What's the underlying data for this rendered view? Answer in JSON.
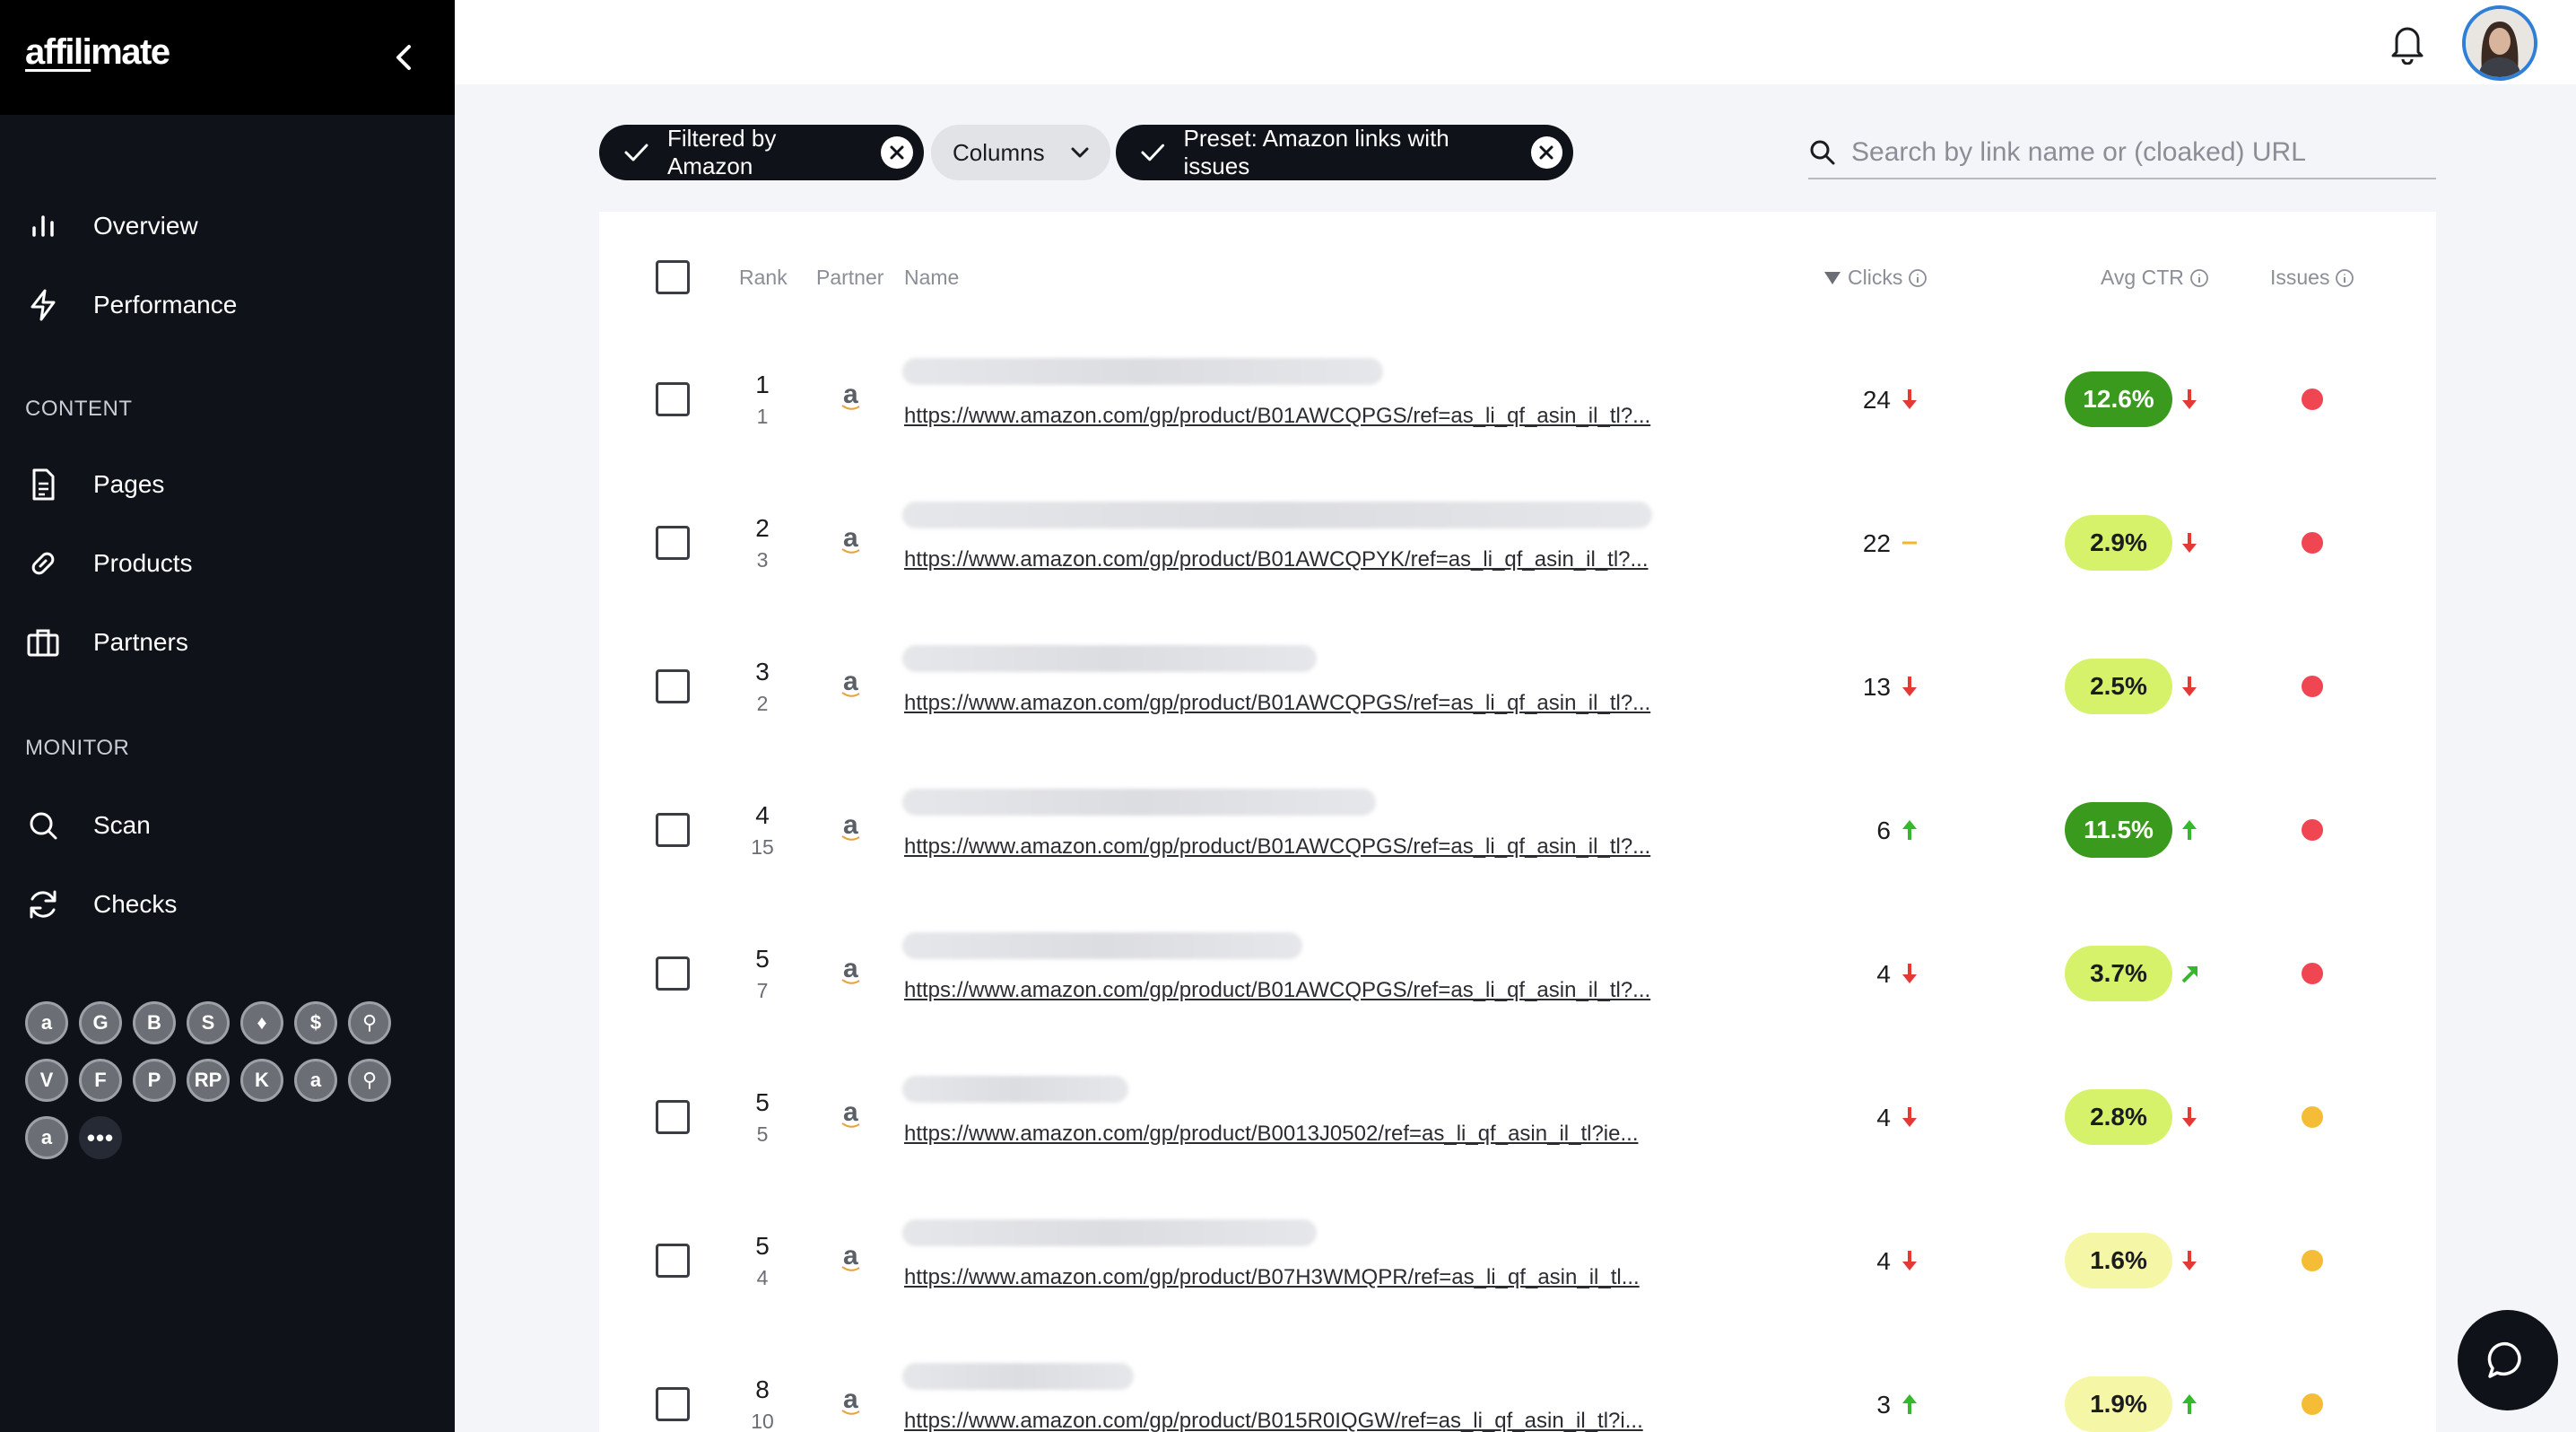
{
  "app": {
    "logo_prefix": "affili",
    "logo_suffix": "mate"
  },
  "sidebar": {
    "nav": [
      {
        "label": "Overview",
        "icon": "bar-chart-icon"
      },
      {
        "label": "Performance",
        "icon": "lightning-icon"
      }
    ],
    "content_section": "CONTENT",
    "content_items": [
      {
        "label": "Pages",
        "icon": "document-icon"
      },
      {
        "label": "Products",
        "icon": "link-icon"
      },
      {
        "label": "Partners",
        "icon": "briefcase-icon"
      }
    ],
    "monitor_section": "MONITOR",
    "monitor_items": [
      {
        "label": "Scan",
        "icon": "search-icon"
      },
      {
        "label": "Checks",
        "icon": "refresh-icon"
      }
    ],
    "partners": [
      "a",
      "G",
      "B",
      "S",
      "♦",
      "$",
      "⚲",
      "V",
      "F",
      "P",
      "RP",
      "K",
      "a",
      "⚲",
      "a"
    ],
    "partners_more": "•••"
  },
  "filters": {
    "amazon": "Filtered by Amazon",
    "columns": "Columns",
    "preset": "Preset: Amazon links with issues"
  },
  "search": {
    "placeholder": "Search by link name or (cloaked) URL"
  },
  "table": {
    "headers": {
      "rank": "Rank",
      "partner": "Partner",
      "name": "Name",
      "clicks": "Clicks",
      "ctr": "Avg CTR",
      "issues": "Issues"
    },
    "rows": [
      {
        "rank": "1",
        "prev_rank": "1",
        "url": "https://www.amazon.com/gp/product/B01AWCQPGS/ref=as_li_qf_asin_il_tl?...",
        "clicks": "24",
        "clicks_trend": "down",
        "ctr": "12.6%",
        "ctr_trend": "down",
        "ctr_level": "high",
        "issue": "error"
      },
      {
        "rank": "2",
        "prev_rank": "3",
        "url": "https://www.amazon.com/gp/product/B01AWCQPYK/ref=as_li_qf_asin_il_tl?...",
        "clicks": "22",
        "clicks_trend": "flat",
        "ctr": "2.9%",
        "ctr_trend": "down",
        "ctr_level": "mid",
        "issue": "error"
      },
      {
        "rank": "3",
        "prev_rank": "2",
        "url": "https://www.amazon.com/gp/product/B01AWCQPGS/ref=as_li_qf_asin_il_tl?...",
        "clicks": "13",
        "clicks_trend": "down",
        "ctr": "2.5%",
        "ctr_trend": "down",
        "ctr_level": "mid",
        "issue": "error"
      },
      {
        "rank": "4",
        "prev_rank": "15",
        "url": "https://www.amazon.com/gp/product/B01AWCQPGS/ref=as_li_qf_asin_il_tl?...",
        "clicks": "6",
        "clicks_trend": "up",
        "ctr": "11.5%",
        "ctr_trend": "up",
        "ctr_level": "high",
        "issue": "error"
      },
      {
        "rank": "5",
        "prev_rank": "7",
        "url": "https://www.amazon.com/gp/product/B01AWCQPGS/ref=as_li_qf_asin_il_tl?...",
        "clicks": "4",
        "clicks_trend": "down",
        "ctr": "3.7%",
        "ctr_trend": "up-right",
        "ctr_level": "mid",
        "issue": "error"
      },
      {
        "rank": "5",
        "prev_rank": "5",
        "url": "https://www.amazon.com/gp/product/B0013J0502/ref=as_li_qf_asin_il_tl?ie...",
        "clicks": "4",
        "clicks_trend": "down",
        "ctr": "2.8%",
        "ctr_trend": "down",
        "ctr_level": "mid",
        "issue": "warning"
      },
      {
        "rank": "5",
        "prev_rank": "4",
        "url": "https://www.amazon.com/gp/product/B07H3WMQPR/ref=as_li_qf_asin_il_tl...",
        "clicks": "4",
        "clicks_trend": "down",
        "ctr": "1.6%",
        "ctr_trend": "down",
        "ctr_level": "low",
        "issue": "warning"
      },
      {
        "rank": "8",
        "prev_rank": "10",
        "url": "https://www.amazon.com/gp/product/B015R0IQGW/ref=as_li_qf_asin_il_tl?i...",
        "clicks": "3",
        "clicks_trend": "up",
        "ctr": "1.9%",
        "ctr_trend": "up",
        "ctr_level": "low",
        "issue": "warning"
      }
    ]
  },
  "colors": {
    "ctr_high_bg": "#3a9a1d",
    "ctr_high_fg": "#ffffff",
    "ctr_mid_bg": "#d6f26b",
    "ctr_mid_fg": "#1b1c1f",
    "ctr_low_bg": "#f6f7a6",
    "ctr_low_fg": "#1b1c1f",
    "down": "#e53935",
    "up": "#35b82b",
    "flat": "#f2b632",
    "issue_error": "#ef4651",
    "issue_warning": "#f5bd35"
  }
}
